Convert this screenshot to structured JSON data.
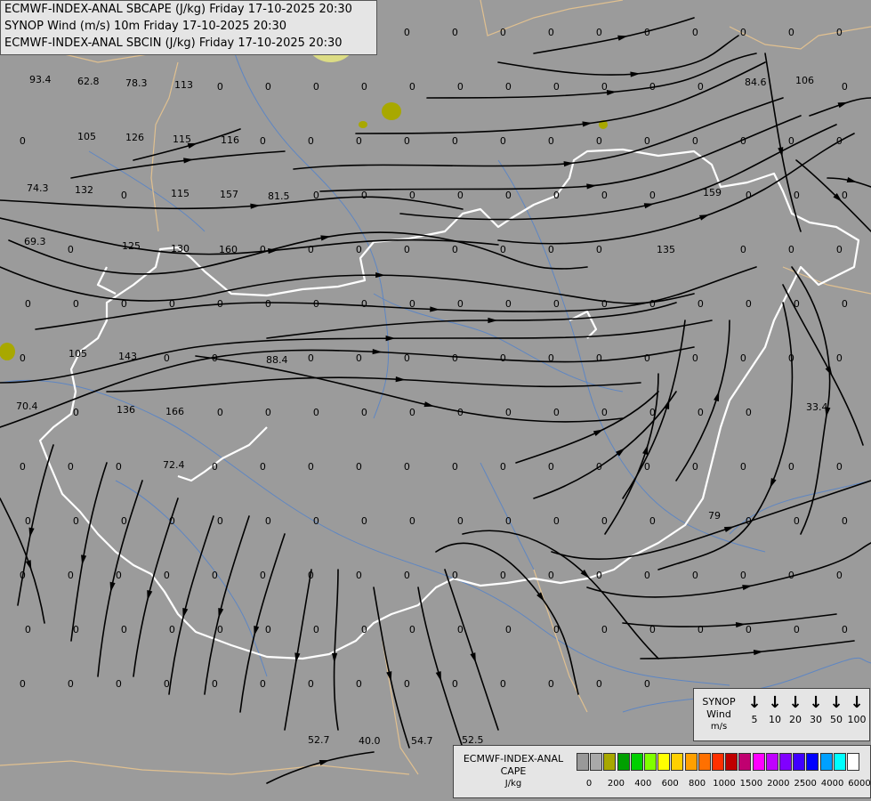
{
  "header": {
    "line1": "ECMWF-INDEX-ANAL SBCAPE (J/kg) Friday 17-10-2025 20:30",
    "line2": "SYNOP Wind (m/s) 10m Friday 17-10-2025 20:30",
    "line3": "ECMWF-INDEX-ANAL SBCIN (J/kg) Friday 17-10-2025 20:30"
  },
  "colors": {
    "background": "#9b9b9b",
    "streamline": "#000000",
    "country_border": "#ffffff",
    "region_border": "#e0c090",
    "river": "#4a7fd0",
    "cape_patch": "#a8a800"
  },
  "cin_labels": [
    {
      "text": "93.4"
    },
    {
      "text": "62.8"
    },
    {
      "text": "78.3"
    },
    {
      "text": "113"
    },
    {
      "text": "105"
    },
    {
      "text": "126"
    },
    {
      "text": "115"
    },
    {
      "text": "116"
    },
    {
      "text": "74.3"
    },
    {
      "text": "132"
    },
    {
      "text": "115"
    },
    {
      "text": "157"
    },
    {
      "text": "81.5"
    },
    {
      "text": "69.3"
    },
    {
      "text": "125"
    },
    {
      "text": "130"
    },
    {
      "text": "160"
    },
    {
      "text": "143"
    },
    {
      "text": "105"
    },
    {
      "text": "88.4"
    },
    {
      "text": "70.4"
    },
    {
      "text": "136"
    },
    {
      "text": "166"
    },
    {
      "text": "72.4"
    },
    {
      "text": "84.6"
    },
    {
      "text": "106"
    },
    {
      "text": "159"
    },
    {
      "text": "135"
    },
    {
      "text": "33.4"
    },
    {
      "text": "52.7"
    },
    {
      "text": "40.0"
    },
    {
      "text": "54.7"
    },
    {
      "text": "52.5"
    },
    {
      "text": "79"
    }
  ],
  "zero_label": "0",
  "wind_legend": {
    "title1": "SYNOP",
    "title2": "Wind",
    "unit": "m/s",
    "speeds": [
      "5",
      "10",
      "20",
      "30",
      "50",
      "100"
    ]
  },
  "cape_legend": {
    "title1": "ECMWF-INDEX-ANAL",
    "title2": "CAPE",
    "unit": "J/kg",
    "colors": [
      "#999999",
      "#a9a9a9",
      "#a8a800",
      "#00a000",
      "#00d000",
      "#80ff00",
      "#ffff00",
      "#ffd000",
      "#ffa000",
      "#ff7000",
      "#ff3000",
      "#c00000",
      "#c00070",
      "#ff00ff",
      "#c000ff",
      "#8000ff",
      "#4000ff",
      "#0000ff",
      "#00a0ff",
      "#00ffff",
      "#ffffff"
    ],
    "ticks": [
      "0",
      "200",
      "400",
      "600",
      "800",
      "1000",
      "1500",
      "2000",
      "2500",
      "4000",
      "6000"
    ]
  }
}
